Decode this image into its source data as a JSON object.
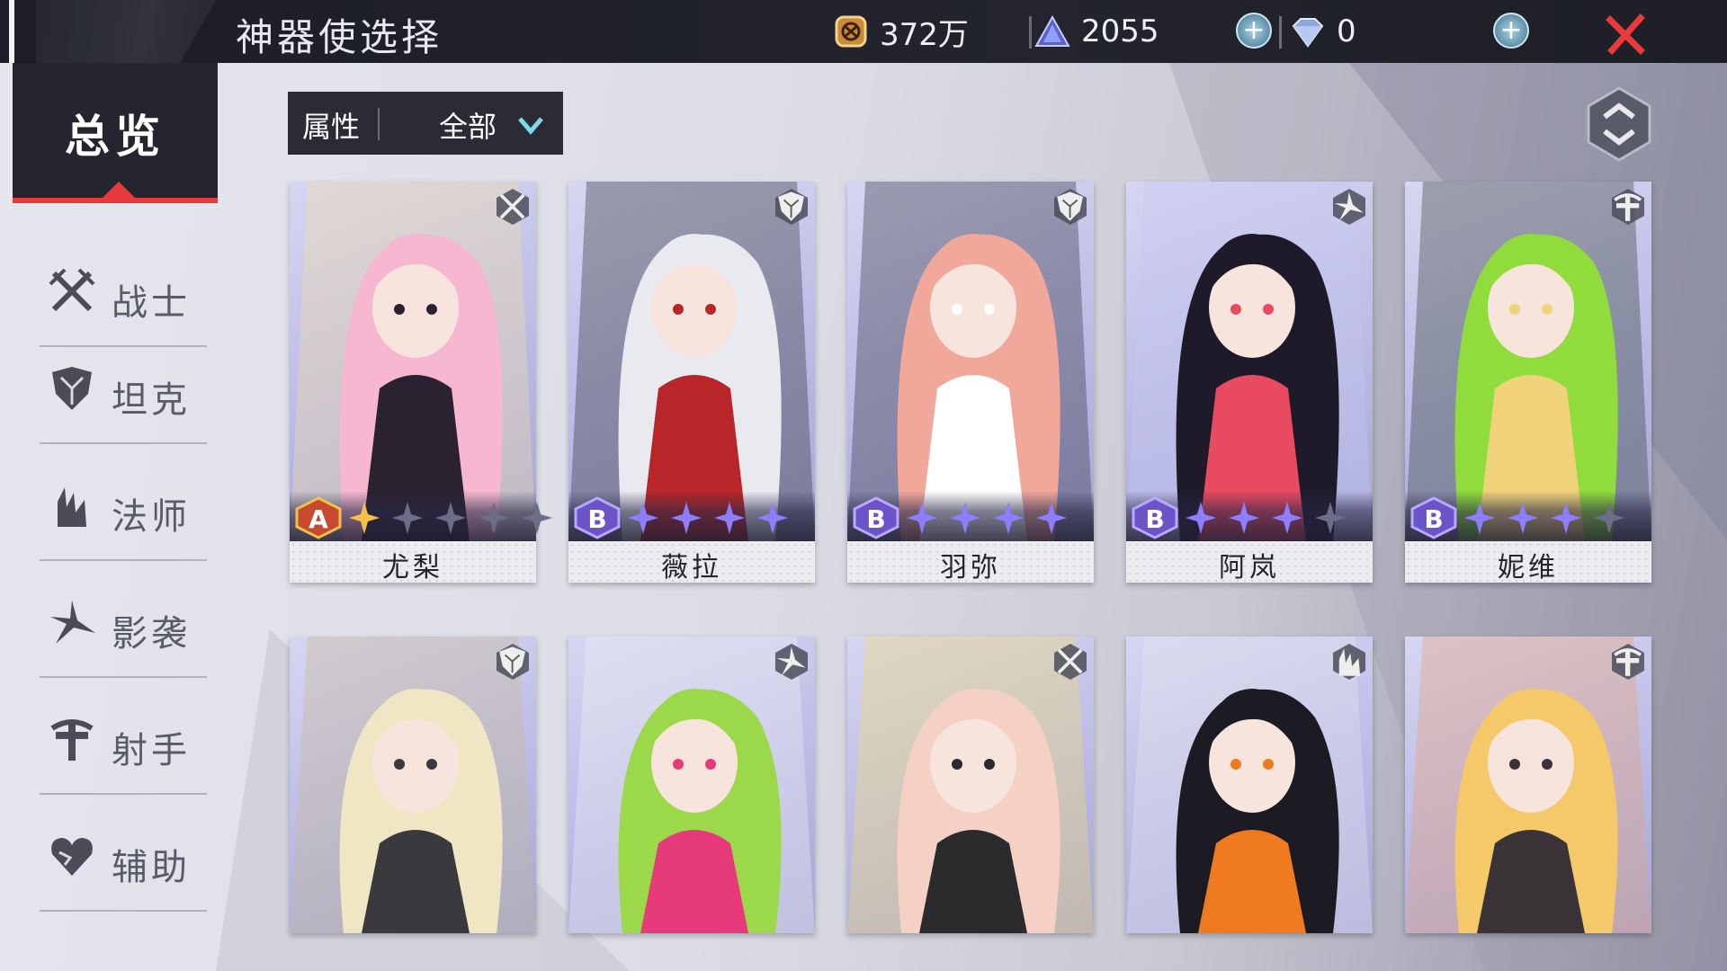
{
  "header": {
    "title": "神器使选择",
    "gold": "372万",
    "crystal": "2055",
    "diamond": "0",
    "close_icon": "close-x-icon"
  },
  "sidebar": {
    "overview": "总览",
    "items": [
      {
        "label": "战士",
        "icon": "crossed-swords-icon"
      },
      {
        "label": "坦克",
        "icon": "shield-icon"
      },
      {
        "label": "法师",
        "icon": "flame-staff-icon"
      },
      {
        "label": "影袭",
        "icon": "shuriken-icon"
      },
      {
        "label": "射手",
        "icon": "crosshair-bow-icon"
      },
      {
        "label": "辅助",
        "icon": "heart-icon"
      }
    ]
  },
  "filter": {
    "label": "属性",
    "value": "全部"
  },
  "colors": {
    "accent_red": "#e83a3a",
    "panel_dark": "#24252e",
    "star_gold": "#f3c04a",
    "star_purple": "#8d7dff"
  },
  "cards": [
    {
      "name": "尤梨",
      "grade": "A",
      "stars_filled": 1,
      "stars_total": 5,
      "role": "warrior",
      "palette": [
        "#f7b7d0",
        "#2a2230",
        "#f4e0a0"
      ]
    },
    {
      "name": "薇拉",
      "grade": "B",
      "stars_filled": 4,
      "stars_total": 4,
      "role": "tank",
      "palette": [
        "#e9e9f0",
        "#b8262a",
        "#2b2b2e"
      ]
    },
    {
      "name": "羽弥",
      "grade": "B",
      "stars_filled": 4,
      "stars_total": 4,
      "role": "tank",
      "palette": [
        "#f1a79a",
        "#ffffff",
        "#2c2c36"
      ]
    },
    {
      "name": "阿岚",
      "grade": "B",
      "stars_filled": 3,
      "stars_total": 4,
      "role": "assassin",
      "palette": [
        "#1e1a2a",
        "#e84a62",
        "#c6c8f0"
      ]
    },
    {
      "name": "妮维",
      "grade": "B",
      "stars_filled": 3,
      "stars_total": 4,
      "role": "archer",
      "palette": [
        "#8fdc3c",
        "#f0d27a",
        "#2d3a2a"
      ]
    },
    {
      "name": "",
      "role": "tank",
      "palette": [
        "#efe6c4",
        "#3a3a3e",
        "#c8b990"
      ]
    },
    {
      "name": "",
      "role": "assassin",
      "palette": [
        "#9bd84a",
        "#e63a7a",
        "#f0f0f4"
      ]
    },
    {
      "name": "",
      "role": "warrior",
      "palette": [
        "#f5d0c4",
        "#2b2b2e",
        "#f3dc6a"
      ]
    },
    {
      "name": "",
      "role": "mage",
      "palette": [
        "#1c1a22",
        "#f07a20",
        "#e6e6ee"
      ]
    },
    {
      "name": "",
      "role": "archer",
      "palette": [
        "#f5c86a",
        "#3a3438",
        "#e8a070"
      ]
    }
  ]
}
